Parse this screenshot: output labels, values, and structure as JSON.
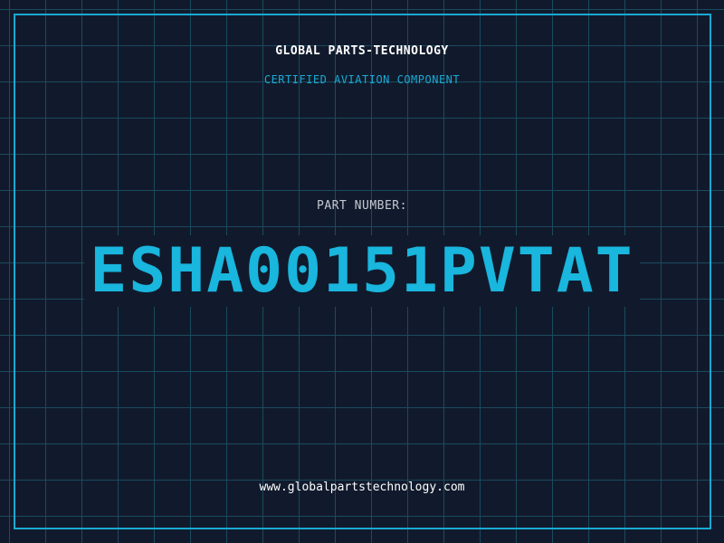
{
  "header": {
    "company": "GLOBAL PARTS-TECHNOLOGY",
    "subtitle": "CERTIFIED AVIATION COMPONENT"
  },
  "main": {
    "label": "PART NUMBER:",
    "part_number": "ESHA00151PVTAT"
  },
  "footer": {
    "url": "www.globalpartstechnology.com"
  },
  "colors": {
    "background": "#111a2c",
    "grid": "#1b4a5e",
    "accent": "#19a9d2",
    "part_number": "#19b6de",
    "label": "#c4c9d1",
    "text": "#ffffff"
  }
}
